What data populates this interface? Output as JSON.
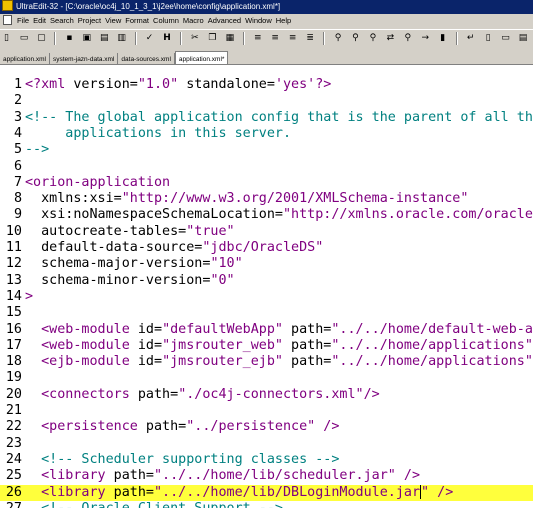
{
  "window": {
    "title": "UltraEdit-32 - [C:\\oracle\\oc4j_10_1_3_1\\j2ee\\home\\config\\application.xml*]"
  },
  "menu": [
    "File",
    "Edit",
    "Search",
    "Project",
    "View",
    "Format",
    "Column",
    "Macro",
    "Advanced",
    "Window",
    "Help"
  ],
  "tabs": [
    {
      "label": "application.xml"
    },
    {
      "label": "system-jazn-data.xml"
    },
    {
      "label": "data-sources.xml"
    },
    {
      "label": "application.xml*"
    }
  ],
  "editor": {
    "current_line": 26,
    "lines": [
      {
        "n": "1",
        "segs": [
          {
            "t": "<?xml",
            "c": "tagc"
          },
          {
            "t": " version=",
            "c": "attr"
          },
          {
            "t": "\"1.0\"",
            "c": "val"
          },
          {
            "t": " standalone=",
            "c": "attr"
          },
          {
            "t": "'yes'",
            "c": "val"
          },
          {
            "t": "?>",
            "c": "tagc"
          }
        ]
      },
      {
        "n": "2",
        "segs": []
      },
      {
        "n": "3",
        "segs": [
          {
            "t": "<!-- The global application config that is the parent of all the other",
            "c": "cmt"
          }
        ]
      },
      {
        "n": "4",
        "segs": [
          {
            "t": "     applications in this server.",
            "c": "cmt"
          }
        ]
      },
      {
        "n": "5",
        "segs": [
          {
            "t": "-->",
            "c": "cmt"
          }
        ]
      },
      {
        "n": "6",
        "segs": []
      },
      {
        "n": "7",
        "segs": [
          {
            "t": "<orion-application",
            "c": "tagc"
          }
        ]
      },
      {
        "n": "8",
        "segs": [
          {
            "t": "  xmlns:xsi=",
            "c": "attr"
          },
          {
            "t": "\"http://www.w3.org/2001/XMLSchema-instance\"",
            "c": "val"
          }
        ]
      },
      {
        "n": "9",
        "segs": [
          {
            "t": "  xsi:noNamespaceSchemaLocation=",
            "c": "attr"
          },
          {
            "t": "\"http://xmlns.oracle.com/oracleas/schema\"",
            "c": "val"
          }
        ]
      },
      {
        "n": "10",
        "segs": [
          {
            "t": "  autocreate-tables=",
            "c": "attr"
          },
          {
            "t": "\"true\"",
            "c": "val"
          }
        ]
      },
      {
        "n": "11",
        "segs": [
          {
            "t": "  default-data-source=",
            "c": "attr"
          },
          {
            "t": "\"jdbc/OracleDS\"",
            "c": "val"
          }
        ]
      },
      {
        "n": "12",
        "segs": [
          {
            "t": "  schema-major-version=",
            "c": "attr"
          },
          {
            "t": "\"10\"",
            "c": "val"
          }
        ]
      },
      {
        "n": "13",
        "segs": [
          {
            "t": "  schema-minor-version=",
            "c": "attr"
          },
          {
            "t": "\"0\"",
            "c": "val"
          }
        ]
      },
      {
        "n": "14",
        "segs": [
          {
            "t": ">",
            "c": "tagc"
          }
        ]
      },
      {
        "n": "15",
        "segs": []
      },
      {
        "n": "16",
        "segs": [
          {
            "t": "  <web-module",
            "c": "tagc"
          },
          {
            "t": " id=",
            "c": "attr"
          },
          {
            "t": "\"defaultWebApp\"",
            "c": "val"
          },
          {
            "t": " path=",
            "c": "attr"
          },
          {
            "t": "\"../../home/default-web-app\"",
            "c": "val"
          }
        ]
      },
      {
        "n": "17",
        "segs": [
          {
            "t": "  <web-module",
            "c": "tagc"
          },
          {
            "t": " id=",
            "c": "attr"
          },
          {
            "t": "\"jmsrouter_web\"",
            "c": "val"
          },
          {
            "t": " path=",
            "c": "attr"
          },
          {
            "t": "\"../../home/applications\"",
            "c": "val"
          }
        ]
      },
      {
        "n": "18",
        "segs": [
          {
            "t": "  <ejb-module",
            "c": "tagc"
          },
          {
            "t": " id=",
            "c": "attr"
          },
          {
            "t": "\"jmsrouter_ejb\"",
            "c": "val"
          },
          {
            "t": " path=",
            "c": "attr"
          },
          {
            "t": "\"../../home/applications\"",
            "c": "val"
          }
        ]
      },
      {
        "n": "19",
        "segs": []
      },
      {
        "n": "20",
        "segs": [
          {
            "t": "  <connectors",
            "c": "tagc"
          },
          {
            "t": " path=",
            "c": "attr"
          },
          {
            "t": "\"./oc4j-connectors.xml\"",
            "c": "val"
          },
          {
            "t": "/>",
            "c": "tagc"
          }
        ]
      },
      {
        "n": "21",
        "segs": []
      },
      {
        "n": "22",
        "segs": [
          {
            "t": "  <persistence",
            "c": "tagc"
          },
          {
            "t": " path=",
            "c": "attr"
          },
          {
            "t": "\"../persistence\"",
            "c": "val"
          },
          {
            "t": " />",
            "c": "tagc"
          }
        ]
      },
      {
        "n": "23",
        "segs": []
      },
      {
        "n": "24",
        "segs": [
          {
            "t": "  <!-- Scheduler supporting classes -->",
            "c": "cmt"
          }
        ]
      },
      {
        "n": "25",
        "segs": [
          {
            "t": "  <library",
            "c": "tagc"
          },
          {
            "t": " path=",
            "c": "attr"
          },
          {
            "t": "\"../../home/lib/scheduler.jar\"",
            "c": "val"
          },
          {
            "t": " />",
            "c": "tagc"
          }
        ]
      },
      {
        "n": "26",
        "segs": [
          {
            "t": "  <library",
            "c": "tagc"
          },
          {
            "t": " path=",
            "c": "attr"
          },
          {
            "t": "\"../../home/lib/DBLoginModule.jar",
            "c": "val"
          },
          {
            "cursor": true
          },
          {
            "t": "\"",
            "c": "val"
          },
          {
            "t": " />",
            "c": "tagc"
          }
        ]
      },
      {
        "n": "27",
        "segs": [
          {
            "t": "  <!-- Oracle Client Support -->",
            "c": "cmt"
          }
        ]
      }
    ]
  }
}
